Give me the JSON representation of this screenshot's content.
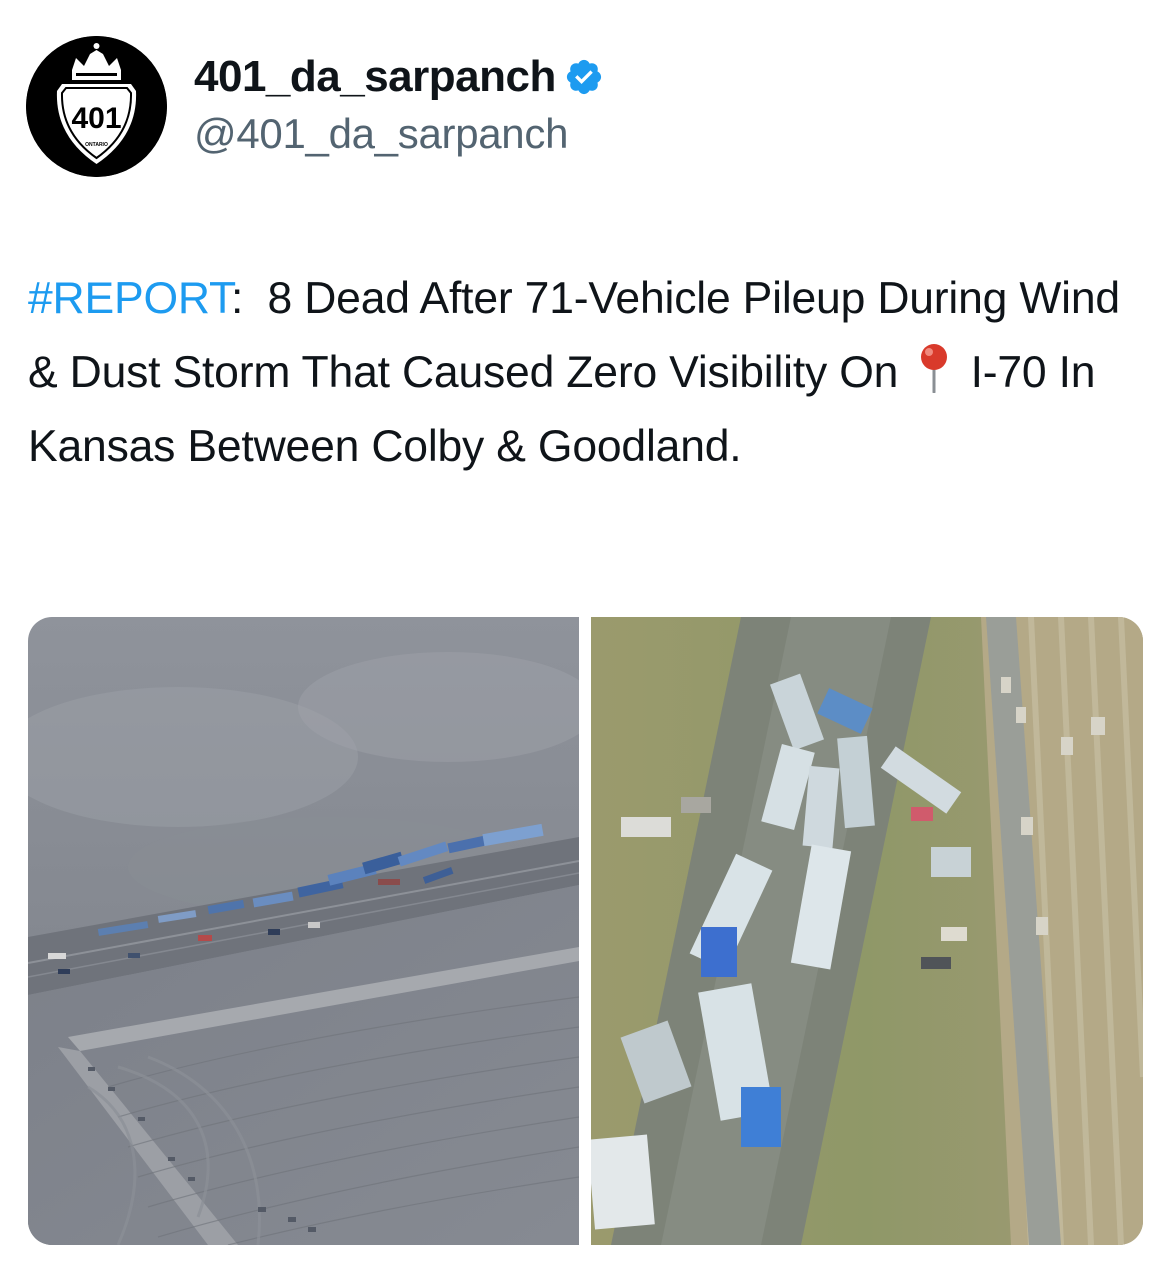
{
  "author": {
    "display_name": "401_da_sarpanch",
    "handle": "@401_da_sarpanch",
    "avatar": {
      "sign_number": "401",
      "sign_region": "ONTARIO"
    },
    "verified_icon": "verified-badge-icon",
    "verified_color": "#1d9bf0"
  },
  "tweet": {
    "hashtag": "#REPORT",
    "text_after_hashtag": ":  8 Dead After 71-Vehicle Pileup During Wind & Dust Storm That Caused Zero Visibility On",
    "pin_icon": "round-pushpin-icon",
    "text_after_pin": "I-70 In Kansas Between Colby & Goodland."
  },
  "media": {
    "photos": [
      {
        "icon": "aerial-photo-field-pileup"
      },
      {
        "icon": "aerial-photo-highway-trucks"
      }
    ]
  },
  "colors": {
    "link": "#1d9bf0",
    "secondary_text": "#536471",
    "primary_text": "#0f1419"
  }
}
